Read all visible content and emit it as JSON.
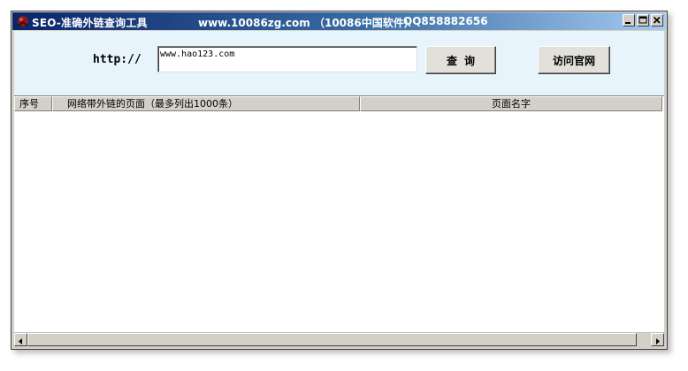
{
  "window": {
    "title": "SEO-准确外链查询工具",
    "site": "www.10086zg.com （10086中国软件）",
    "qq": "QQ858882656",
    "controls": [
      "minimize-icon",
      "maximize-icon",
      "close-icon"
    ]
  },
  "form": {
    "prefix": "http://",
    "url_value": "www.hao123.com",
    "query_label": "查询",
    "visit_label": "访问官网"
  },
  "list": {
    "columns": [
      "序号",
      "网络带外链的页面（最多列出1000条）",
      "页面名字"
    ],
    "rows": []
  },
  "colors": {
    "title_gradient_start": "#0a246a",
    "title_gradient_end": "#a6caf0",
    "top_panel_bg": "#e8f4fc",
    "chrome": "#d4d0c8"
  }
}
